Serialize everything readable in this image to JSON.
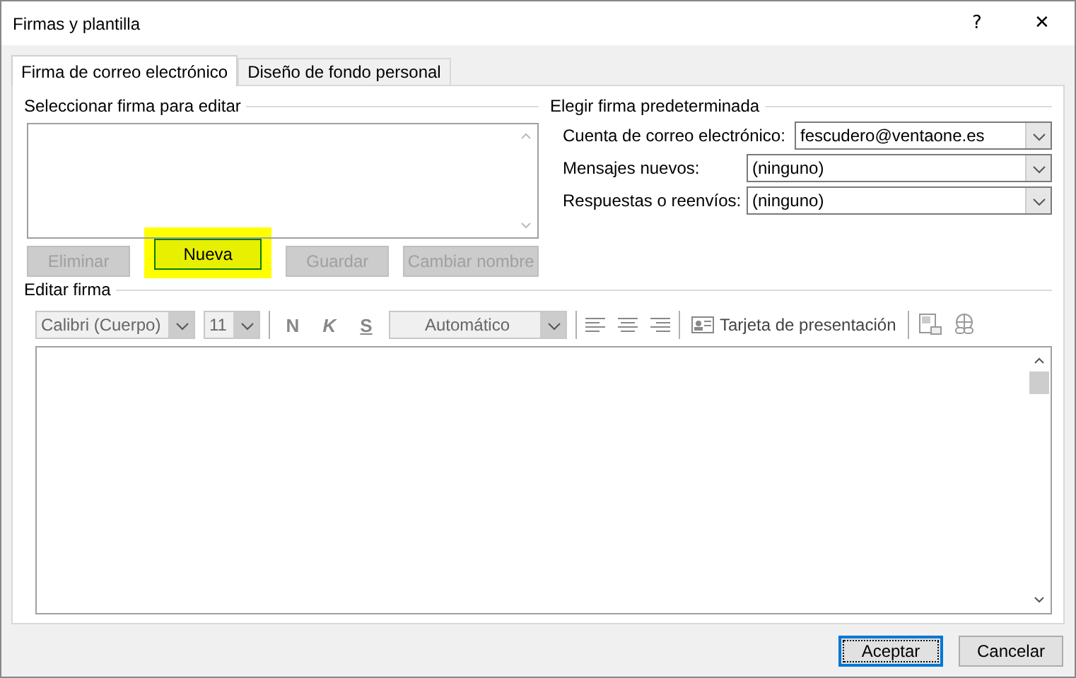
{
  "window": {
    "title": "Firmas y plantilla",
    "help": "?",
    "close": "✕"
  },
  "tabs": [
    {
      "label": "Firma de correo electrónico",
      "selected": true
    },
    {
      "label": "Diseño de fondo personal",
      "selected": false
    }
  ],
  "select_section": {
    "title": "Seleccionar firma para editar",
    "buttons": [
      {
        "label": "Eliminar",
        "disabled": true,
        "highlighted": false
      },
      {
        "label": "Nueva",
        "disabled": false,
        "highlighted": true
      },
      {
        "label": "Guardar",
        "disabled": true,
        "highlighted": false
      },
      {
        "label": "Cambiar nombre",
        "disabled": true,
        "highlighted": false
      }
    ]
  },
  "default_section": {
    "title": "Elegir firma predeterminada",
    "fields": [
      {
        "label": "Cuenta de correo electrónico:",
        "value": "fescudero@ventaone.es"
      },
      {
        "label": "Mensajes nuevos:",
        "value": "(ninguno)"
      },
      {
        "label": "Respuestas o reenvíos:",
        "value": "(ninguno)"
      }
    ]
  },
  "edit_section": {
    "title": "Editar firma",
    "toolbar": {
      "font": "Calibri (Cuerpo)",
      "size": "11",
      "bold": "N",
      "italic": "K",
      "underline": "S",
      "font_color_label": "Automático",
      "card": "Tarjeta de presentación"
    }
  },
  "footer_buttons": [
    {
      "label": "Aceptar",
      "default": true
    },
    {
      "label": "Cancelar",
      "default": false
    }
  ]
}
